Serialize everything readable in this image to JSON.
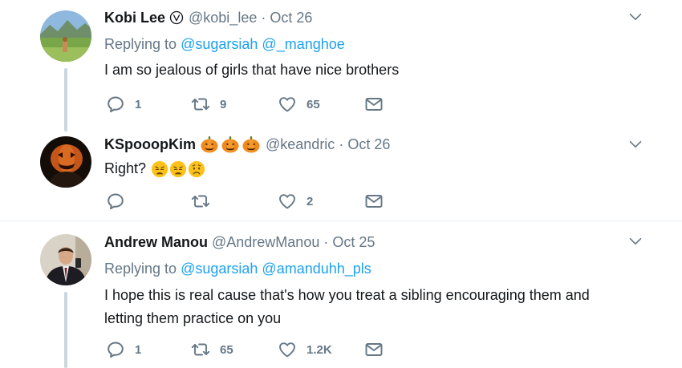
{
  "tweets": [
    {
      "name": "Kobi Lee",
      "handle": "@kobi_lee",
      "dot": "·",
      "time": "Oct 26",
      "replying_prefix": "Replying to",
      "replying_to": [
        "@sugarsiah",
        "@_manghoe"
      ],
      "text": "I am so jealous of girls that have nice brothers",
      "replies": "1",
      "retweets": "9",
      "likes": "65"
    },
    {
      "name": "KSpooopKim",
      "handle": "@keandric",
      "dot": "·",
      "time": "Oct 26",
      "name_emoji": [
        "jack-o-lantern",
        "jack-o-lantern",
        "jack-o-lantern"
      ],
      "text": "Right?",
      "text_emoji": [
        "weary-face",
        "weary-face",
        "worried-face"
      ],
      "replies": "",
      "retweets": "",
      "likes": "2"
    },
    {
      "name": "Andrew Manou",
      "handle": "@AndrewManou",
      "dot": "·",
      "time": "Oct 25",
      "replying_prefix": "Replying to",
      "replying_to": [
        "@sugarsiah",
        "@amanduhh_pls"
      ],
      "text_lines": [
        "I hope this is real cause that's how you treat a sibling encouraging them and",
        "letting them practice on you"
      ],
      "replies": "1",
      "retweets": "65",
      "likes": "1.2K"
    }
  ],
  "icons": {
    "reply": "reply-icon",
    "retweet": "retweet-icon",
    "like": "heart-icon",
    "dm": "envelope-icon",
    "more": "chevron-down-icon",
    "verified": "verified-badge-icon"
  },
  "colors": {
    "text": "#14171a",
    "secondary": "#657786",
    "link": "#1da1f2",
    "divider": "#e6ecf0",
    "thread_line": "#ccd6dd"
  }
}
